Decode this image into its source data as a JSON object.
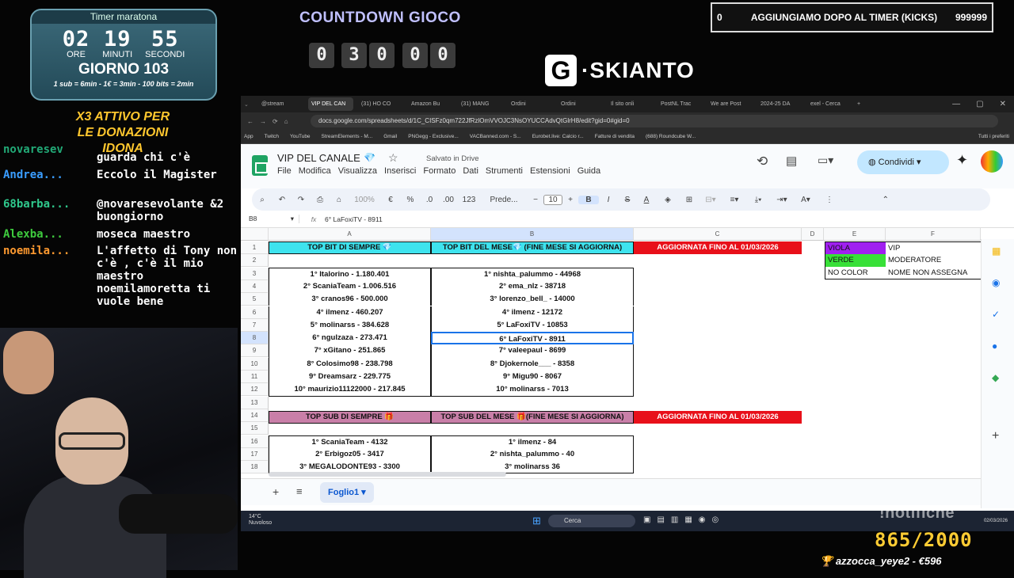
{
  "timer": {
    "title": "Timer maratona",
    "hours": "02",
    "minutes": "19",
    "seconds": "55",
    "hours_label": "ORE",
    "minutes_label": "MINUTI",
    "seconds_label": "SECONDI",
    "day": "GIORNO 103",
    "rules": "1 sub = 6min - 1€ = 3min - 100 bits = 2min"
  },
  "x3": {
    "line1": "X3 ATTIVO PER",
    "line2": "LE DONAZIONI",
    "line3": "IDONA"
  },
  "chat": [
    {
      "user": "novaresev",
      "msg": "guarda chi c'è"
    },
    {
      "user": "Andrea...",
      "msg": "Eccolo il Magister"
    },
    {
      "user": "68barba...",
      "msg": "@novaresevolante &2 buongiorno"
    },
    {
      "user": "Alexba...",
      "msg": "moseca maestro"
    },
    {
      "user": "noemila...",
      "msg": "L'affetto di Tony non c'è , c'è il mio maestro noemilamoretta ti vuole bene"
    }
  ],
  "countdown": {
    "title": "COUNTDOWN GIOCO",
    "digits": [
      "0",
      "3",
      "0",
      "0",
      "0"
    ]
  },
  "logo": {
    "mark": "G",
    "text": "·SKIANTO"
  },
  "kicks": {
    "left": "0",
    "title": "AGGIUNGIAMO DOPO AL TIMER (KICKS)",
    "right": "999999"
  },
  "browser": {
    "tabs": [
      "@stream",
      "VIP DEL CAN",
      "(31) HO CO",
      "Amazon Bu",
      "(31) MANG",
      "Ordini",
      "Ordini",
      "Il sito onli",
      "PostNL Trac",
      "We are Post",
      "2024-25 DA",
      "exel - Cerca"
    ],
    "url": "docs.google.com/spreadsheets/d/1C_CISFz0qm722JfRzlOmVVOJC3NsOYUCCAdvQtGlrH8/edit?gid=0#gid=0",
    "bookmarks": [
      "App",
      "Twitch",
      "YouTube",
      "StreamElements - M...",
      "Gmail",
      "PNGegg - Exclusive...",
      "VACBanned.com - S...",
      "Eurobet.live: Calcio r...",
      "Fatture di vendita",
      "(688) Roundcube W..."
    ],
    "bookmarks_right": "Tutti i preferiti"
  },
  "sheet": {
    "title": "VIP DEL CANALE",
    "gem": "💎",
    "saved": "Salvato in Drive",
    "menus": [
      "File",
      "Modifica",
      "Visualizza",
      "Inserisci",
      "Formato",
      "Dati",
      "Strumenti",
      "Estensioni",
      "Guida"
    ],
    "share": "Condividi",
    "zoom": "100%",
    "font": "Prede...",
    "font_size": "10",
    "number_format": "123",
    "cell_ref": "B8",
    "formula": "6° LaFoxiTV - 8911",
    "columns": [
      "A",
      "B",
      "C",
      "D",
      "E",
      "F"
    ],
    "rows": [
      "1",
      "2",
      "3",
      "4",
      "5",
      "6",
      "7",
      "8",
      "9",
      "10",
      "11",
      "12",
      "13",
      "14",
      "15",
      "16",
      "17",
      "18"
    ],
    "bit_header_a": "TOP BIT DI SEMPRE 💎",
    "bit_header_b": "TOP BIT DEL MESE💎 (FINE MESE SI AGGIORNA)",
    "updated_1": "AGGIORNATA FINO AL  01/03/2026",
    "bits_all_time": [
      "1° Italorino - 1.180.401",
      "2° ScaniaTeam - 1.006.516",
      "3° cranos96 - 500.000",
      "4° ilmenz - 460.207",
      "5° molinarss - 384.628",
      "6° ngulzaza - 273.471",
      "7° xGitano - 251.865",
      "8° Colosimo98 - 238.798",
      "9° Dreamsarz - 229.775",
      "10° maurizio11122000 - 217.845"
    ],
    "bits_month": [
      "1° nishta_palummo - 44968",
      "2° ema_nlz - 38718",
      "3° lorenzo_bell_ - 14000",
      "4° ilmenz - 12172",
      "5° LaFoxiTV - 10853",
      "6° LaFoxiTV - 8911",
      "7° valeepaul - 8699",
      "8° Djokernole___ - 8358",
      "9° Migu90 - 8067",
      "10° molinarss - 7013"
    ],
    "legend": [
      {
        "color_name": "VIOLA",
        "meaning": "VIP",
        "color": "#a020f0"
      },
      {
        "color_name": "VERDE",
        "meaning": "MODERATORE",
        "color": "#38e038"
      },
      {
        "color_name": "NO COLOR",
        "meaning": "NOME NON ASSEGNA",
        "color": "#ffffff"
      }
    ],
    "sub_header_a": "TOP SUB DI SEMPRE 🎁",
    "sub_header_b": "TOP SUB DEL MESE 🎁(FINE MESE SI AGGIORNA)",
    "updated_2": "AGGIORNATA FINO AL  01/03/2026",
    "subs_all_time": [
      "1° ScaniaTeam - 4132",
      "2° Erbigoz05 - 3417",
      "3° MEGALODONTE93 - 3300"
    ],
    "subs_month": [
      "1° ilmenz - 84",
      "2° nishta_palummo - 40",
      "3° molinarss 36"
    ],
    "sheet_tab": "Foglio1"
  },
  "taskbar": {
    "weather_temp": "14°C",
    "weather_desc": "Nuvoloso",
    "search": "Cerca",
    "time": "",
    "date": "02/03/2026"
  },
  "overlay": {
    "notifiche": "!notifiche",
    "counter": "865/2000",
    "donation": "azzocca_yeye2 - €596"
  }
}
